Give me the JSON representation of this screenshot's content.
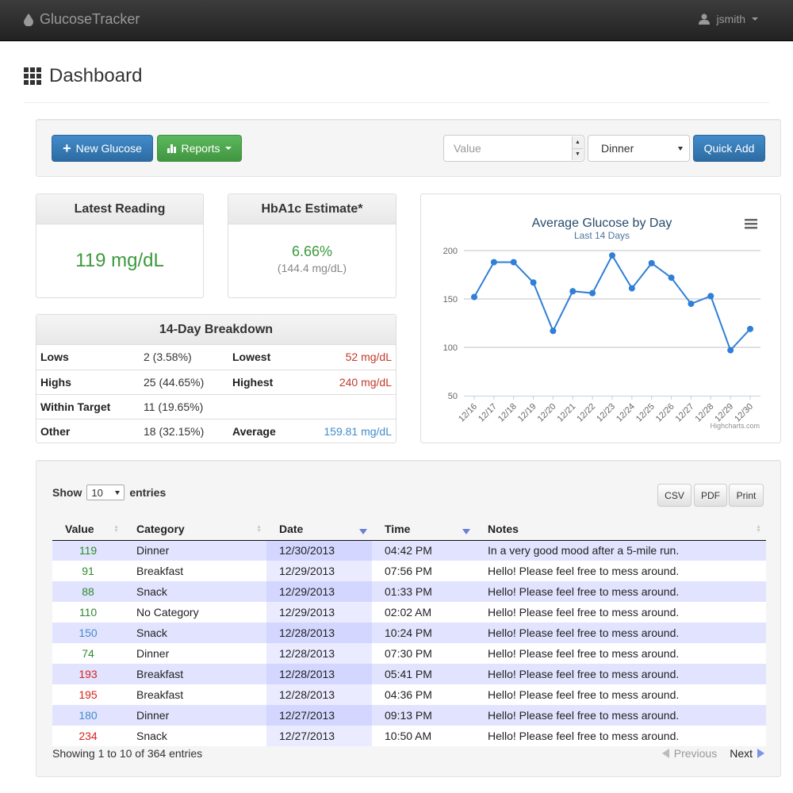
{
  "navbar": {
    "brand": "GlucoseTracker",
    "user": "jsmith"
  },
  "page": {
    "title": "Dashboard"
  },
  "toolbar": {
    "new_glucose": "New Glucose",
    "reports": "Reports",
    "value_placeholder": "Value",
    "category_selected": "Dinner",
    "quick_add": "Quick Add"
  },
  "latest": {
    "title": "Latest Reading",
    "value": "119 mg/dL"
  },
  "hba1c": {
    "title": "HbA1c Estimate*",
    "value": "6.66%",
    "sub": "(144.4 mg/dL)"
  },
  "breakdown": {
    "title": "14-Day Breakdown",
    "rows": [
      {
        "label": "Lows",
        "value": "2 (3.58%)",
        "label2": "Lowest",
        "value2": "52 mg/dL"
      },
      {
        "label": "Highs",
        "value": "25 (44.65%)",
        "label2": "Highest",
        "value2": "240 mg/dL"
      },
      {
        "label": "Within Target",
        "value": "11 (19.65%)",
        "label2": "",
        "value2": ""
      },
      {
        "label": "Other",
        "value": "18 (32.15%)",
        "label2": "Average",
        "value2": "159.81 mg/dL"
      }
    ]
  },
  "chart_data": {
    "type": "line",
    "title": "Average Glucose by Day",
    "subtitle": "Last 14 Days",
    "categories": [
      "12/16",
      "12/17",
      "12/18",
      "12/19",
      "12/20",
      "12/21",
      "12/22",
      "12/23",
      "12/24",
      "12/25",
      "12/26",
      "12/27",
      "12/28",
      "12/29",
      "12/30"
    ],
    "values": [
      152,
      188,
      188,
      167,
      117,
      158,
      156,
      195,
      161,
      187,
      172,
      145,
      153,
      97,
      119
    ],
    "ylim": [
      50,
      200
    ],
    "yticks": [
      50,
      100,
      150,
      200
    ],
    "grid": true,
    "color": "#2f7ed8",
    "credit": "Highcharts.com"
  },
  "table": {
    "show_label": "Show",
    "length": "10",
    "entries_label": "entries",
    "buttons": [
      "CSV",
      "PDF",
      "Print"
    ],
    "headers": [
      "Value",
      "Category",
      "Date",
      "Time",
      "Notes"
    ],
    "rows": [
      {
        "value": "119",
        "level": "green",
        "category": "Dinner",
        "date": "12/30/2013",
        "time": "04:42 PM",
        "notes": "In a very good mood after a 5-mile run."
      },
      {
        "value": "91",
        "level": "green",
        "category": "Breakfast",
        "date": "12/29/2013",
        "time": "07:56 PM",
        "notes": "Hello! Please feel free to mess around."
      },
      {
        "value": "88",
        "level": "green",
        "category": "Snack",
        "date": "12/29/2013",
        "time": "01:33 PM",
        "notes": "Hello! Please feel free to mess around."
      },
      {
        "value": "110",
        "level": "green",
        "category": "No Category",
        "date": "12/29/2013",
        "time": "02:02 AM",
        "notes": "Hello! Please feel free to mess around."
      },
      {
        "value": "150",
        "level": "blue",
        "category": "Snack",
        "date": "12/28/2013",
        "time": "10:24 PM",
        "notes": "Hello! Please feel free to mess around."
      },
      {
        "value": "74",
        "level": "green",
        "category": "Dinner",
        "date": "12/28/2013",
        "time": "07:30 PM",
        "notes": "Hello! Please feel free to mess around."
      },
      {
        "value": "193",
        "level": "red",
        "category": "Breakfast",
        "date": "12/28/2013",
        "time": "05:41 PM",
        "notes": "Hello! Please feel free to mess around."
      },
      {
        "value": "195",
        "level": "red",
        "category": "Breakfast",
        "date": "12/28/2013",
        "time": "04:36 PM",
        "notes": "Hello! Please feel free to mess around."
      },
      {
        "value": "180",
        "level": "blue",
        "category": "Dinner",
        "date": "12/27/2013",
        "time": "09:13 PM",
        "notes": "Hello! Please feel free to mess around."
      },
      {
        "value": "234",
        "level": "red",
        "category": "Snack",
        "date": "12/27/2013",
        "time": "10:50 AM",
        "notes": "Hello! Please feel free to mess around."
      }
    ],
    "info": "Showing 1 to 10 of 364 entries",
    "previous": "Previous",
    "next": "Next"
  }
}
